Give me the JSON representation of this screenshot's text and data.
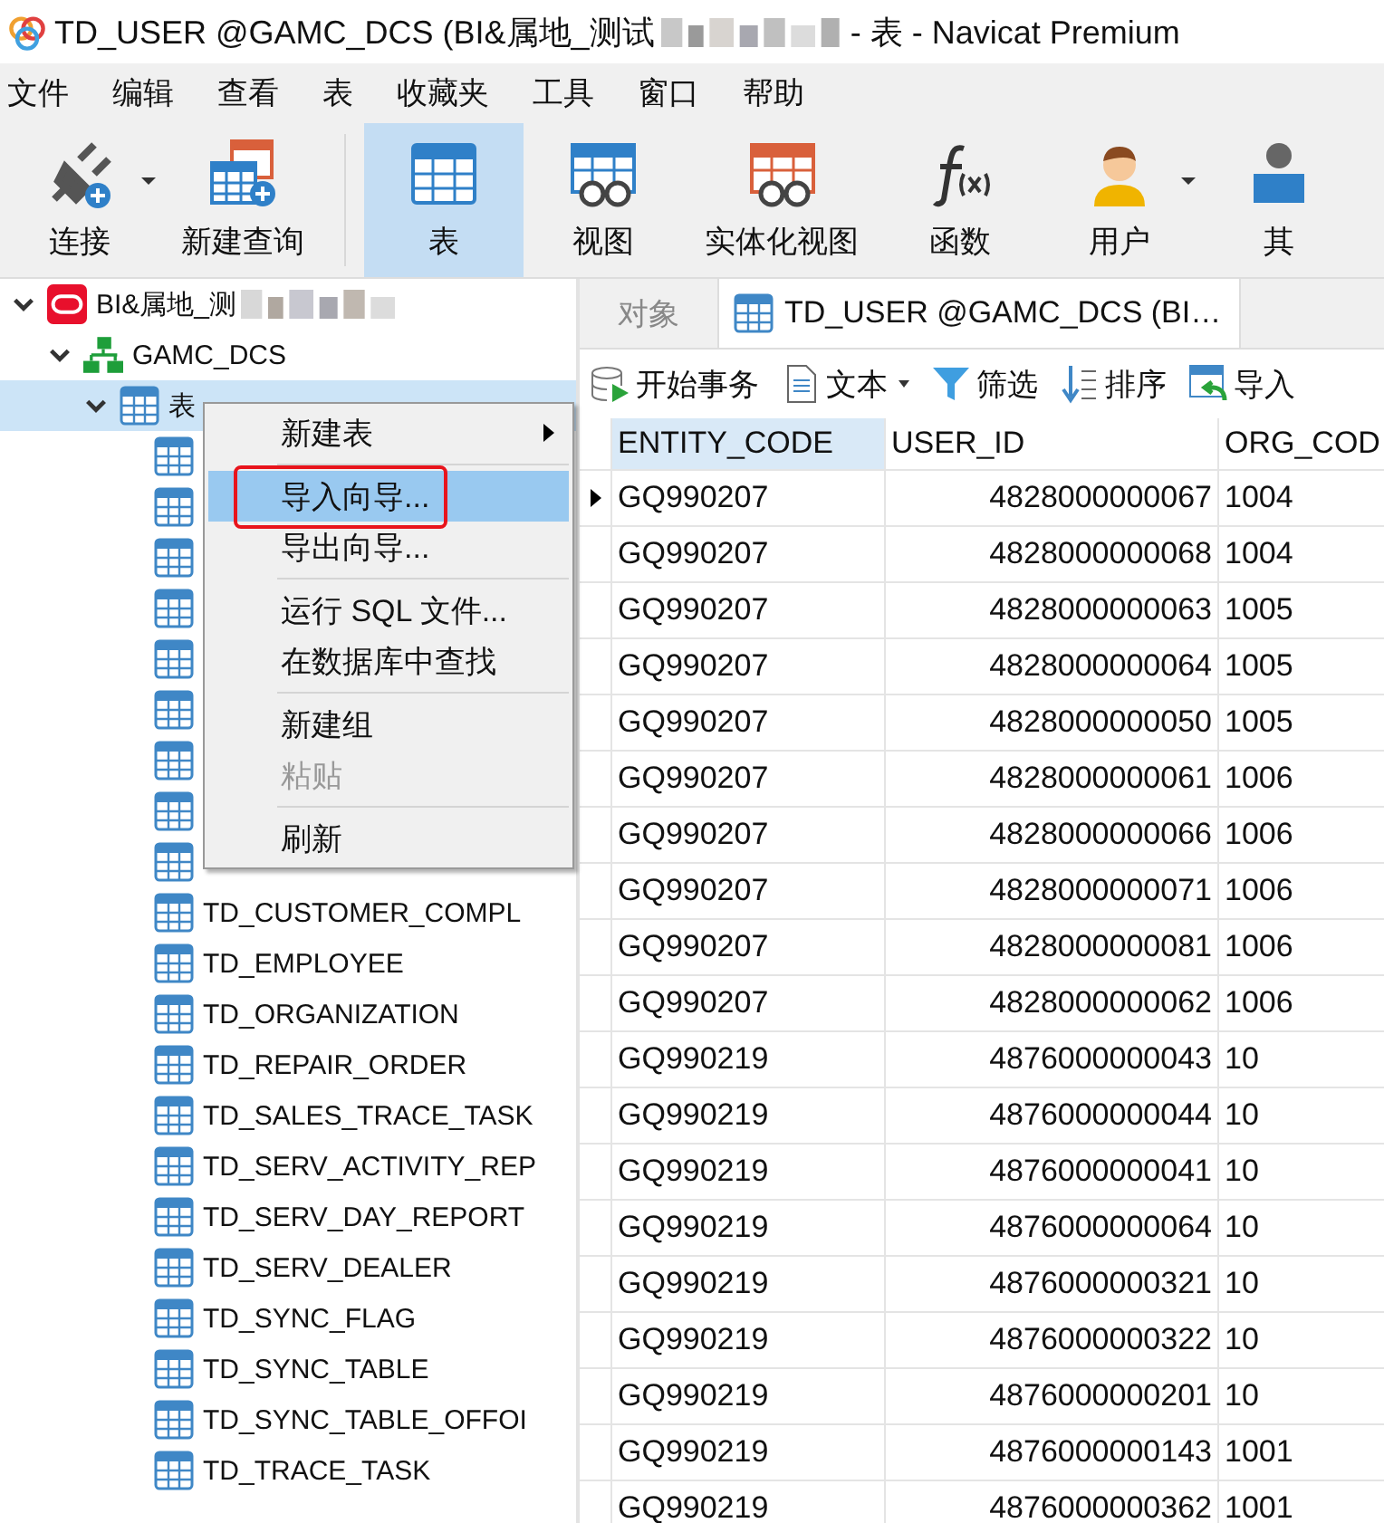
{
  "window": {
    "title": "TD_USER @GAMC_DCS (BI&属地_测试",
    "title_suffix": "- 表 - Navicat Premium"
  },
  "menu_bar": [
    "文件",
    "编辑",
    "查看",
    "表",
    "收藏夹",
    "工具",
    "窗口",
    "帮助"
  ],
  "toolbar": [
    {
      "label": "连接",
      "kind": "connect",
      "dropdown": true,
      "selected": false
    },
    {
      "label": "新建查询",
      "kind": "query",
      "dropdown": false,
      "selected": false
    },
    {
      "label": "表",
      "kind": "table",
      "dropdown": false,
      "selected": true
    },
    {
      "label": "视图",
      "kind": "view",
      "dropdown": false,
      "selected": false
    },
    {
      "label": "实体化视图",
      "kind": "matview",
      "dropdown": false,
      "selected": false
    },
    {
      "label": "函数",
      "kind": "function",
      "dropdown": false,
      "selected": false
    },
    {
      "label": "用户",
      "kind": "user",
      "dropdown": true,
      "selected": false
    },
    {
      "label": "其",
      "kind": "other",
      "dropdown": false,
      "selected": false
    }
  ],
  "tree": [
    {
      "label": "BI&属地_测",
      "kind": "connection",
      "expanded": true,
      "selected": false,
      "children": [
        {
          "label": "GAMC_DCS",
          "kind": "schema",
          "expanded": true,
          "selected": false,
          "children": [
            {
              "label": "表",
              "kind": "folder",
              "expanded": true,
              "selected": true,
              "children": [
                {
                  "kind": "table"
                },
                {
                  "kind": "table"
                },
                {
                  "kind": "table"
                },
                {
                  "kind": "table"
                },
                {
                  "kind": "table"
                },
                {
                  "kind": "table"
                },
                {
                  "kind": "table"
                },
                {
                  "kind": "table"
                },
                {
                  "kind": "table"
                },
                {
                  "kind": "table",
                  "label": "TD_CUSTOMER_COMPL"
                },
                {
                  "kind": "table",
                  "label": "TD_EMPLOYEE"
                },
                {
                  "kind": "table",
                  "label": "TD_ORGANIZATION"
                },
                {
                  "kind": "table",
                  "label": "TD_REPAIR_ORDER"
                },
                {
                  "kind": "table",
                  "label": "TD_SALES_TRACE_TASK"
                },
                {
                  "kind": "table",
                  "label": "TD_SERV_ACTIVITY_REP"
                },
                {
                  "kind": "table",
                  "label": "TD_SERV_DAY_REPORT"
                },
                {
                  "kind": "table",
                  "label": "TD_SERV_DEALER"
                },
                {
                  "kind": "table",
                  "label": "TD_SYNC_FLAG"
                },
                {
                  "kind": "table",
                  "label": "TD_SYNC_TABLE"
                },
                {
                  "kind": "table",
                  "label": "TD_SYNC_TABLE_OFFOI"
                },
                {
                  "kind": "table",
                  "label": "TD_TRACE_TASK"
                }
              ]
            }
          ]
        }
      ]
    }
  ],
  "tabs": [
    {
      "label": "对象",
      "icon": false,
      "selected": false
    },
    {
      "label": "TD_USER @GAMC_DCS (BI…",
      "icon": true,
      "selected": true
    }
  ],
  "grid_toolbar": [
    {
      "label": "开始事务",
      "kind": "transaction",
      "dropdown": false
    },
    {
      "label": "文本",
      "kind": "text",
      "dropdown": true
    },
    {
      "label": "筛选",
      "kind": "filter",
      "dropdown": false
    },
    {
      "label": "排序",
      "kind": "sort",
      "dropdown": false
    },
    {
      "label": "导入",
      "kind": "import",
      "dropdown": false
    }
  ],
  "grid": {
    "columns": [
      "ENTITY_CODE",
      "USER_ID",
      "ORG_COD"
    ],
    "rows": [
      {
        "cells": [
          "GQ990207",
          "4828000000067",
          "1004"
        ],
        "selected": true
      },
      {
        "cells": [
          "GQ990207",
          "4828000000068",
          "1004"
        ],
        "selected": false
      },
      {
        "cells": [
          "GQ990207",
          "4828000000063",
          "1005"
        ],
        "selected": false
      },
      {
        "cells": [
          "GQ990207",
          "4828000000064",
          "1005"
        ],
        "selected": false
      },
      {
        "cells": [
          "GQ990207",
          "4828000000050",
          "1005"
        ],
        "selected": false
      },
      {
        "cells": [
          "GQ990207",
          "4828000000061",
          "1006"
        ],
        "selected": false
      },
      {
        "cells": [
          "GQ990207",
          "4828000000066",
          "1006"
        ],
        "selected": false
      },
      {
        "cells": [
          "GQ990207",
          "4828000000071",
          "1006"
        ],
        "selected": false
      },
      {
        "cells": [
          "GQ990207",
          "4828000000081",
          "1006"
        ],
        "selected": false
      },
      {
        "cells": [
          "GQ990207",
          "4828000000062",
          "1006"
        ],
        "selected": false
      },
      {
        "cells": [
          "GQ990219",
          "4876000000043",
          "10"
        ],
        "selected": false
      },
      {
        "cells": [
          "GQ990219",
          "4876000000044",
          "10"
        ],
        "selected": false
      },
      {
        "cells": [
          "GQ990219",
          "4876000000041",
          "10"
        ],
        "selected": false
      },
      {
        "cells": [
          "GQ990219",
          "4876000000064",
          "10"
        ],
        "selected": false
      },
      {
        "cells": [
          "GQ990219",
          "4876000000321",
          "10"
        ],
        "selected": false
      },
      {
        "cells": [
          "GQ990219",
          "4876000000322",
          "10"
        ],
        "selected": false
      },
      {
        "cells": [
          "GQ990219",
          "4876000000201",
          "10"
        ],
        "selected": false
      },
      {
        "cells": [
          "GQ990219",
          "4876000000143",
          "1001"
        ],
        "selected": false
      },
      {
        "cells": [
          "GQ990219",
          "4876000000362",
          "1001"
        ],
        "selected": false
      }
    ]
  },
  "context_menu": [
    {
      "kind": "item",
      "label": "新建表",
      "submenu": true,
      "selected": false,
      "disabled": false
    },
    {
      "kind": "separator"
    },
    {
      "kind": "item",
      "label": "导入向导...",
      "submenu": false,
      "selected": true,
      "disabled": false
    },
    {
      "kind": "item",
      "label": "导出向导...",
      "submenu": false,
      "selected": false,
      "disabled": false
    },
    {
      "kind": "separator"
    },
    {
      "kind": "item",
      "label": "运行 SQL 文件...",
      "submenu": false,
      "selected": false,
      "disabled": false
    },
    {
      "kind": "item",
      "label": "在数据库中查找",
      "submenu": false,
      "selected": false,
      "disabled": false
    },
    {
      "kind": "separator"
    },
    {
      "kind": "item",
      "label": "新建组",
      "submenu": false,
      "selected": false,
      "disabled": false
    },
    {
      "kind": "item",
      "label": "粘贴",
      "submenu": false,
      "selected": false,
      "disabled": true
    },
    {
      "kind": "separator"
    },
    {
      "kind": "item",
      "label": "刷新",
      "submenu": false,
      "selected": false,
      "disabled": false
    }
  ]
}
